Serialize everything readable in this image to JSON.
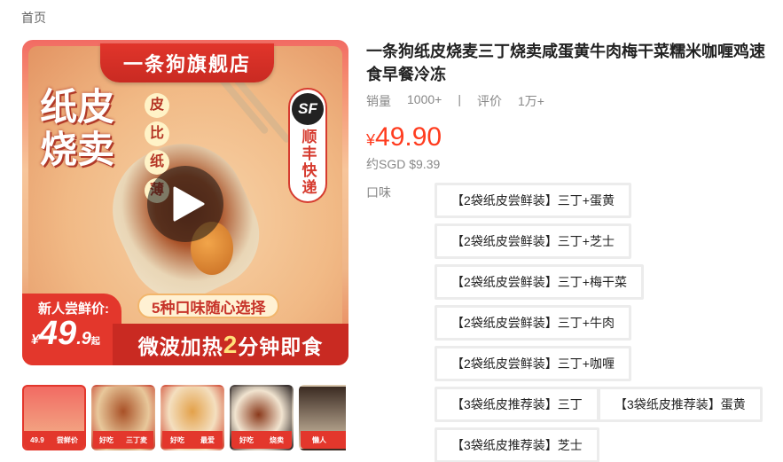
{
  "breadcrumb": {
    "home": "首页"
  },
  "main_image": {
    "store_banner": "一条狗旗舰店",
    "big_title_line1": "纸皮",
    "big_title_line2": "烧卖",
    "tags": [
      "皮",
      "比",
      "纸",
      "薄"
    ],
    "sf_logo": "SF",
    "sf_text": "顺丰快递",
    "new_user_label": "新人尝鲜价:",
    "price_currency": "¥",
    "price_int": "49",
    "price_dec": ".9",
    "price_suffix": "起",
    "flavor_pill": "5种口味随心选择",
    "heat_pre": "微波加热",
    "heat_num": "2",
    "heat_post": "分钟即食",
    "play_icon": "play-icon"
  },
  "thumbnails": [
    {
      "strip": [
        "49.9",
        "尝鲜价"
      ]
    },
    {
      "strip": [
        "好吃",
        "三丁麦"
      ]
    },
    {
      "strip": [
        "好吃",
        "最爱"
      ]
    },
    {
      "strip": [
        "好吃",
        "烧卖"
      ]
    },
    {
      "strip": [
        "懒人",
        ""
      ]
    }
  ],
  "product": {
    "title": "一条狗纸皮烧麦三丁烧卖咸蛋黄牛肉梅干菜糯米咖喱鸡速食早餐冷冻",
    "sales_label": "销量",
    "sales_value": "1000+",
    "separator": "|",
    "reviews_label": "评价",
    "reviews_value": "1万+",
    "price_currency": "¥",
    "price_value": "49.90",
    "sgd_price": "约SGD $9.39",
    "flavor_label": "口味",
    "options": [
      "【2袋纸皮尝鲜装】三丁+蛋黄",
      "【2袋纸皮尝鲜装】三丁+芝士",
      "【2袋纸皮尝鲜装】三丁+梅干菜",
      "【2袋纸皮尝鲜装】三丁+牛肉",
      "【2袋纸皮尝鲜装】三丁+咖喱",
      "【3袋纸皮推荐装】三丁",
      "【3袋纸皮推荐装】蛋黄",
      "【3袋纸皮推荐装】芝士"
    ]
  },
  "colors": {
    "accent_red": "#ff3c1f",
    "banner_red": "#e3372c"
  }
}
